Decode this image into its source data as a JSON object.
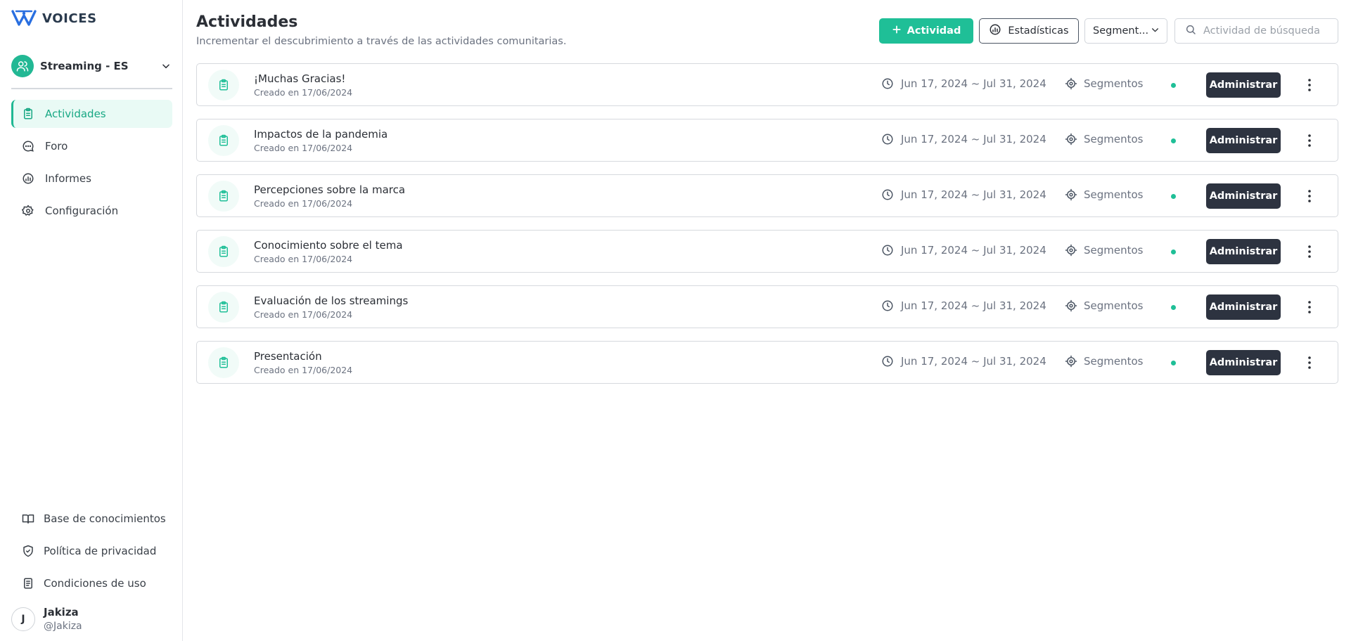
{
  "app": {
    "brand": "VOICES",
    "accent_color": "#1fbf97",
    "dark_button_color": "#2d3340"
  },
  "sidebar": {
    "community": {
      "name": "Streaming - ES",
      "icon": "users-icon"
    },
    "nav": [
      {
        "label": "Actividades",
        "icon": "clipboard-icon",
        "active": true
      },
      {
        "label": "Foro",
        "icon": "chat-icon",
        "active": false
      },
      {
        "label": "Informes",
        "icon": "chart-icon",
        "active": false
      },
      {
        "label": "Configuración",
        "icon": "gear-icon",
        "active": false
      }
    ],
    "bottom": [
      {
        "label": "Base de conocimientos",
        "icon": "book-icon"
      },
      {
        "label": "Política de privacidad",
        "icon": "shield-icon"
      },
      {
        "label": "Condiciones de uso",
        "icon": "document-icon"
      }
    ],
    "user": {
      "initial": "J",
      "name": "Jakiza",
      "handle": "@Jakiza"
    }
  },
  "header": {
    "title": "Actividades",
    "subtitle": "Incrementar el descubrimiento a través de las actividades comunitarias.",
    "add_button": "Actividad",
    "stats_button": "Estadísticas",
    "segment_select": "Segment...",
    "search_placeholder": "Actividad de búsqueda"
  },
  "activities": [
    {
      "title": "¡Muchas Gracias!",
      "created": "Creado en 17/06/2024",
      "dates": "Jun 17, 2024 ~ Jul 31, 2024",
      "segments": "Segmentos",
      "status": "active",
      "action": "Administrar"
    },
    {
      "title": "Impactos de la pandemia",
      "created": "Creado en 17/06/2024",
      "dates": "Jun 17, 2024 ~ Jul 31, 2024",
      "segments": "Segmentos",
      "status": "active",
      "action": "Administrar"
    },
    {
      "title": "Percepciones sobre la marca",
      "created": "Creado en 17/06/2024",
      "dates": "Jun 17, 2024 ~ Jul 31, 2024",
      "segments": "Segmentos",
      "status": "active",
      "action": "Administrar"
    },
    {
      "title": "Conocimiento sobre el tema",
      "created": "Creado en 17/06/2024",
      "dates": "Jun 17, 2024 ~ Jul 31, 2024",
      "segments": "Segmentos",
      "status": "active",
      "action": "Administrar"
    },
    {
      "title": "Evaluación de los streamings",
      "created": "Creado en 17/06/2024",
      "dates": "Jun 17, 2024 ~ Jul 31, 2024",
      "segments": "Segmentos",
      "status": "active",
      "action": "Administrar"
    },
    {
      "title": "Presentación",
      "created": "Creado en 17/06/2024",
      "dates": "Jun 17, 2024 ~ Jul 31, 2024",
      "segments": "Segmentos",
      "status": "active",
      "action": "Administrar"
    }
  ]
}
